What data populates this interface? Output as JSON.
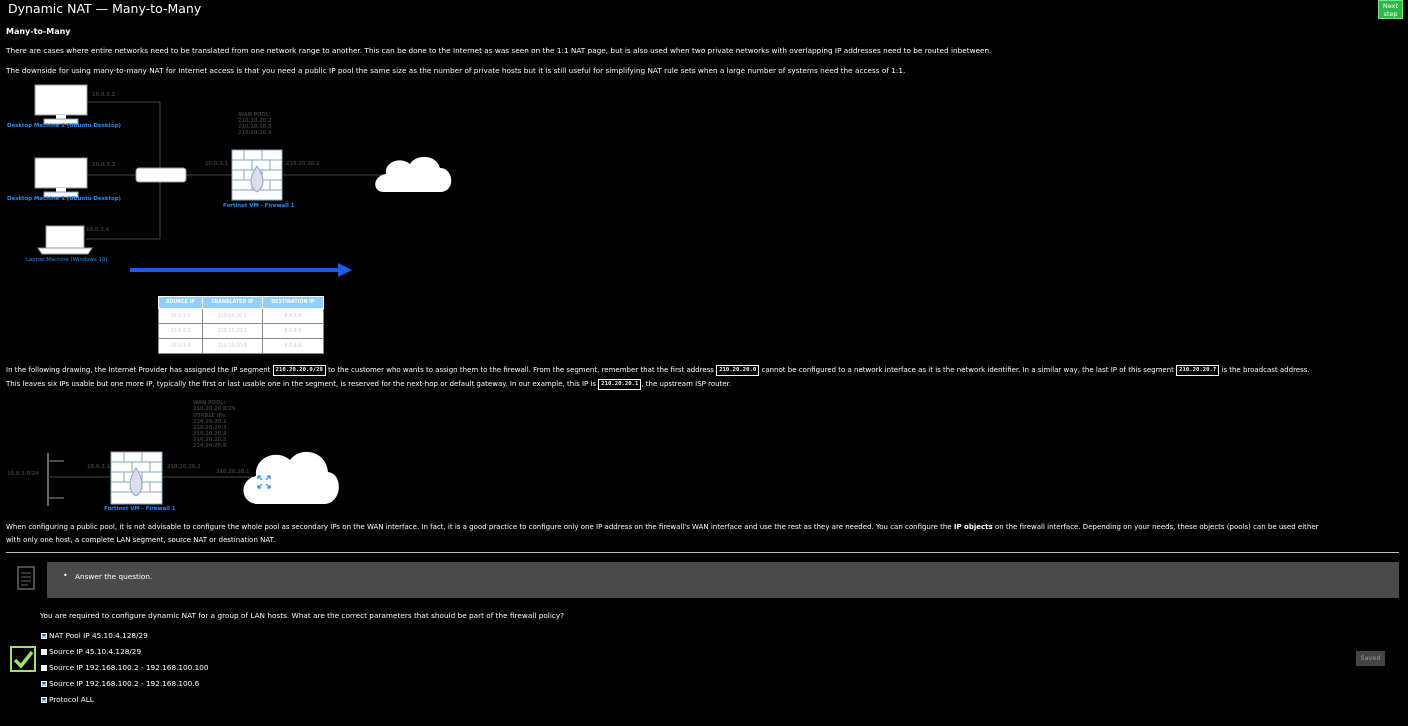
{
  "header": {
    "title": "Dynamic NAT — Many-to-Many",
    "next_label": "Next step"
  },
  "section_heading": "Many-to-Many",
  "paragraphs": {
    "p1": "There are cases where entire networks need to be translated from one network range to another. This can be done to the Internet as was seen on the 1:1 NAT page, but is also used when two private networks with overlapping IP addresses need to be routed inbetween.",
    "p2": "The downside for using many-to-many NAT for Internet access is that you need a public IP pool the same size as the number of private hosts but it is still useful for simplifying NAT rule sets when a large number of systems need the access of 1:1.",
    "p3a": "In the following drawing, the Internet Provider has assigned the IP segment",
    "p3_code1": "210.20.20.0/29",
    "p3b": "to the customer who wants to assign them to the firewall. From the segment, remember that the first address",
    "p3_code2": "210.20.20.0",
    "p3c": "cannot be configured to a network interface as it is the network identifier. In a similar way, the last IP of this segment",
    "p3_code3": "210.20.20.7",
    "p3d": "is the broadcast address.",
    "p4a": "This leaves six IPs usable but one more IP, typically the first or last usable one in the segment, is reserved for the next-hop or default gateway. In our example, this IP is",
    "p4_code": "210.20.20.1",
    "p4b": ", the upstream ISP router.",
    "p5a": "When configuring a public pool, it is not advisable to configure the whole pool as secondary IPs on the WAN interface. In fact, it is a good practice to configure only one IP address on the firewall's WAN interface and use the rest as they are needed. You can configure the",
    "p5_bold": "IP objects",
    "p5b": "on the firewall interface. Depending on your needs, these objects (pools) can be used either",
    "p6": "with only one host, a complete LAN segment, source NAT or destination NAT."
  },
  "diagram1": {
    "desktop2_label": "Desktop Machine 2 (Ubuntu Desktop)",
    "desktop2_ip": "10.0.3.2",
    "desktop1_label": "Desktop Machine 1 (Ubuntu Desktop)",
    "desktop1_ip": "10.0.3.3",
    "laptop_label": "Laptop Machine (Windows 10)",
    "laptop_ip": "10.0.3.4",
    "fw_label": "Fortinet VM - Firewall 1",
    "fw_lan_ip": "10.0.3.1",
    "fw_wan_ip": "210.20.20.2",
    "wan_pool_title": "WAN POOL:",
    "wan_pool": [
      "210.10.20.2",
      "210.10.20.3",
      "210.10.20.4"
    ]
  },
  "nat_table": {
    "headers": [
      "SOURCE IP",
      "TRANSLATED IP",
      "DESTINATION IP"
    ],
    "rows": [
      [
        "10.0.3.2",
        "210.10.20.2",
        "8.8.8.8"
      ],
      [
        "10.0.3.3",
        "210.10.20.3",
        "8.8.8.8"
      ],
      [
        "10.0.3.4",
        "210.10.20.4",
        "8.8.8.8"
      ]
    ]
  },
  "diagram2": {
    "lan_net": "10.0.3.0/24",
    "fw_lan_ip": "10.0.3.1",
    "fw_wan_ip": "210.20.20.2",
    "isp_ip": "210.20.20.1",
    "fw_label": "Fortinet VM - Firewall 1",
    "wan_pool_title": "WAN POOL:",
    "wan_pool_net": "210.20.20.0/29",
    "usable_title": "USABLE IPs:",
    "usable": [
      "210.20.20.2",
      "210.20.20.3",
      "210.20.20.4",
      "210.20.20.5",
      "210.20.20.6"
    ]
  },
  "task": {
    "bullet": "•",
    "text": "Answer the question."
  },
  "question": {
    "text": "You are required to configure dynamic NAT for a group of LAN hosts. What are the correct parameters that should be part of the firewall policy?",
    "options": [
      {
        "label": "NAT Pool IP 45.10.4.128/29",
        "checked": true
      },
      {
        "label": "Source IP 45.10.4.128/29",
        "checked": false
      },
      {
        "label": "Source IP 192.168.100.2 - 192.168.100.100",
        "checked": false
      },
      {
        "label": "Source IP 192.168.100.2 - 192.168.100.6",
        "checked": true
      },
      {
        "label": "Protocol ALL",
        "checked": true
      }
    ],
    "saved_label": "Saved"
  },
  "colors": {
    "accent_green": "#2fb84a",
    "diagram_blue": "#1e8fff",
    "arrow_blue": "#1a5fe0",
    "panel_gray": "#4a4a4a"
  }
}
